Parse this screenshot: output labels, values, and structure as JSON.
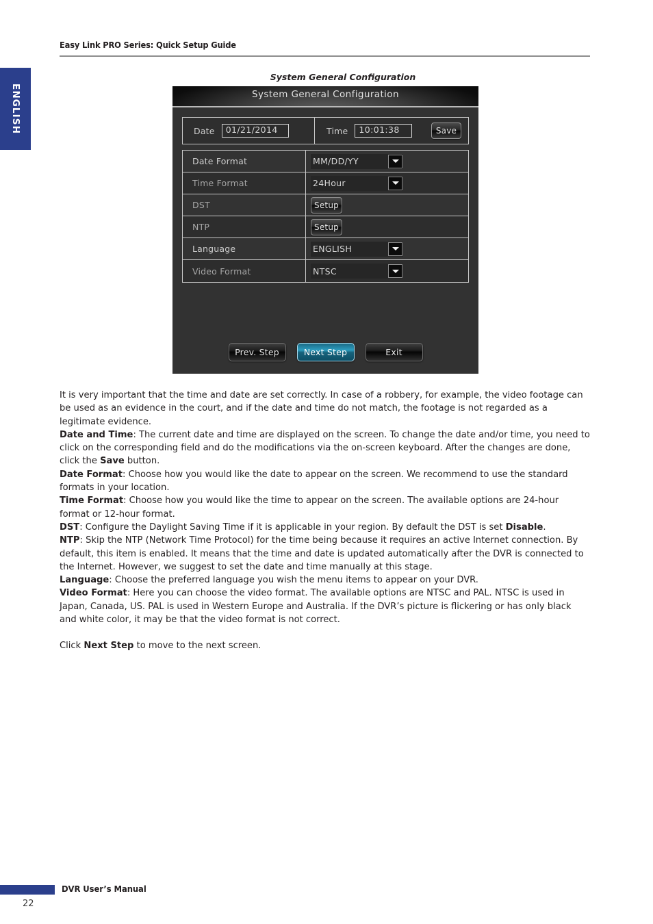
{
  "header": {
    "title": "Easy Link PRO Series: Quick Setup Guide"
  },
  "language_tab": {
    "label": "ENGLISH"
  },
  "figure": {
    "caption": "System General Configuration"
  },
  "dvr": {
    "window_title": "System General Configuration",
    "datetime_row": {
      "date_label": "Date",
      "date_value": "01/21/2014",
      "time_label": "Time",
      "time_value": "10:01:38",
      "save_label": "Save"
    },
    "settings": [
      {
        "label": "Date Format",
        "control": "dropdown",
        "value": "MM/DD/YY"
      },
      {
        "label": "Time Format",
        "control": "dropdown",
        "value": "24Hour"
      },
      {
        "label": "DST",
        "control": "button",
        "value": "Setup"
      },
      {
        "label": "NTP",
        "control": "button",
        "value": "Setup"
      },
      {
        "label": "Language",
        "control": "dropdown",
        "value": "ENGLISH"
      },
      {
        "label": "Video Format",
        "control": "dropdown",
        "value": "NTSC"
      }
    ],
    "nav": {
      "prev_label": "Prev. Step",
      "next_label": "Next Step",
      "exit_label": "Exit"
    },
    "colors": {
      "panel_bg": "#323232",
      "titlebar_dark": "#060606",
      "accent_blue": "#2e9ec0"
    }
  },
  "body": {
    "para_intro": "It is very important that the time and date are set correctly. In case of a robbery, for example, the video footage can be used as an evidence in the court, and if the date and time do not match, the footage is not regarded as a legitimate evidence.",
    "p_datetime_term": "Date and Time",
    "p_datetime_text_1": ": The current date and time are displayed on the screen. To change the date and/or time, you need to click on the corresponding field and do the modifications via the on-screen keyboard. After the changes are done, click the ",
    "p_datetime_bold_2": "Save",
    "p_datetime_text_2": " button.",
    "p_dateformat_term": "Date Format",
    "p_dateformat_text": ": Choose how you would like the date to appear on the screen. We recommend to use the standard formats in your location.",
    "p_timeformat_term": "Time Format",
    "p_timeformat_text": ": Choose how you would like the time to appear on the screen. The available options are 24-hour format or 12-hour format.",
    "p_dst_term": "DST",
    "p_dst_text_1": ": Configure the Daylight Saving Time if it is applicable in your region. By default the DST is set ",
    "p_dst_bold_2": "Disable",
    "p_dst_text_2": ".",
    "p_ntp_term": "NTP",
    "p_ntp_text": ": Skip the NTP (Network Time Protocol) for the time being because it requires an active Internet connection. By default, this item is enabled. It means that the time and date is updated automatically after the DVR is connected to the Internet. However, we suggest to set the date and time manually at this stage.",
    "p_language_term": "Language",
    "p_language_text": ": Choose the preferred language you wish the menu items to appear on your DVR.",
    "p_videoformat_term": "Video Format",
    "p_videoformat_text": ": Here you can choose the video format. The available options are NTSC and PAL. NTSC is used in Japan, Canada, US. PAL is used in Western Europe and Australia. If the DVR’s picture is flickering or has only black and white color, it may be that the video format is not correct.",
    "p_click_text_1": "Click ",
    "p_click_bold": "Next Step",
    "p_click_text_2": " to move to the next screen."
  },
  "footer": {
    "manual_title": "DVR User’s Manual",
    "page_number": "22"
  }
}
